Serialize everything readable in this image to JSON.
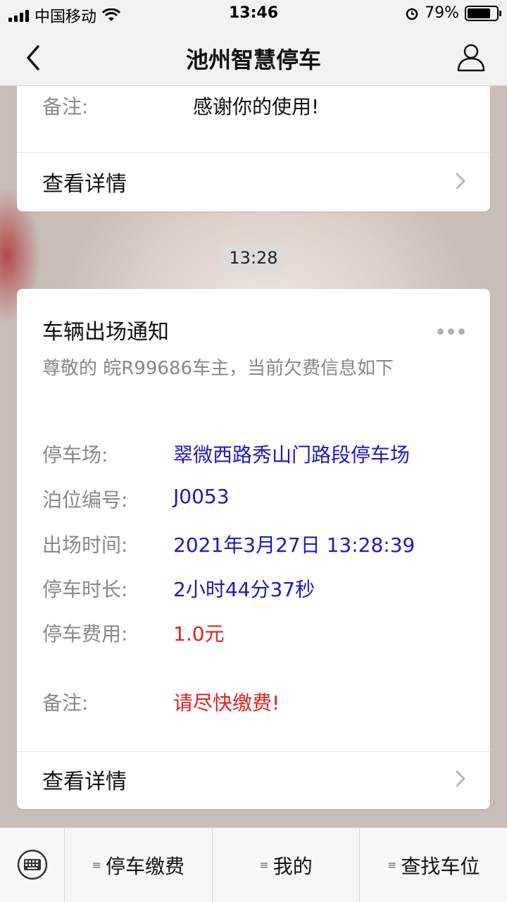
{
  "status_bar": {
    "carrier": "中国移动",
    "time": "13:46",
    "battery_percent": "79%",
    "battery_level": 0.79
  },
  "nav": {
    "title": "池州智慧停车"
  },
  "message1": {
    "remark_label": "备注:",
    "remark_value": "感谢你的使用!",
    "detail_label": "查看详情"
  },
  "timestamp": "13:28",
  "message2": {
    "title": "车辆出场通知",
    "subtitle": "尊敬的 皖R99686车主，当前欠费信息如下",
    "rows": [
      {
        "label": "停车场:",
        "value": "翠微西路秀山门路段停车场"
      },
      {
        "label": "泊位编号:",
        "value": "J0053"
      },
      {
        "label": "出场时间:",
        "value": "2021年3月27日 13:28:39"
      },
      {
        "label": "停车时长:",
        "value": "2小时44分37秒"
      },
      {
        "label": "停车费用:",
        "value": "1.0元"
      }
    ],
    "remark_label": "备注:",
    "remark_value": "请尽快缴费!",
    "detail_label": "查看详情",
    "accent_blue": "#1a1ab8",
    "accent_red": "#e0211c"
  },
  "bottom_menu": {
    "items": [
      {
        "label": "停车缴费"
      },
      {
        "label": "我的"
      },
      {
        "label": "查找车位"
      }
    ]
  }
}
